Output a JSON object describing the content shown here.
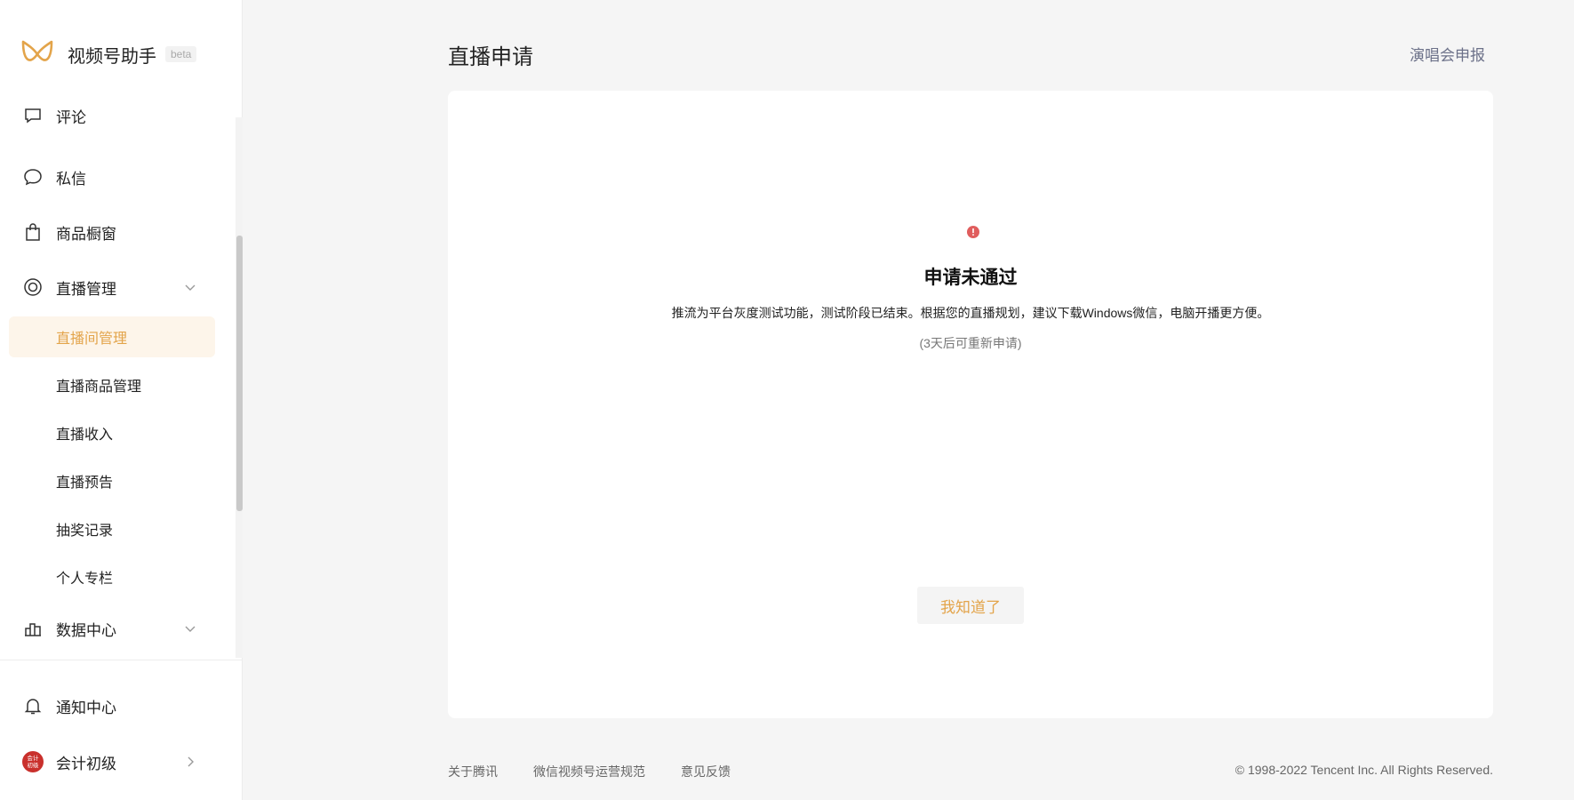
{
  "app": {
    "name": "视频号助手",
    "beta": "beta"
  },
  "colors": {
    "accent": "#e3a44a",
    "active_bg": "#fdf5ea",
    "error": "#e05d5d",
    "link": "#6c7189"
  },
  "sidebar": {
    "items": [
      {
        "label": "评论",
        "icon": "comment-icon"
      },
      {
        "label": "私信",
        "icon": "message-bubble-icon"
      },
      {
        "label": "商品橱窗",
        "icon": "shopping-bag-icon"
      },
      {
        "label": "直播管理",
        "icon": "live-broadcast-icon",
        "expanded": true
      },
      {
        "label": "直播间管理",
        "active": true
      },
      {
        "label": "直播商品管理"
      },
      {
        "label": "直播收入"
      },
      {
        "label": "直播预告"
      },
      {
        "label": "抽奖记录"
      },
      {
        "label": "个人专栏"
      },
      {
        "label": "数据中心",
        "icon": "bar-chart-icon",
        "expanded": false
      }
    ],
    "bottom": {
      "notify": {
        "label": "通知中心",
        "icon": "bell-icon"
      },
      "account": {
        "label": "会计初级",
        "avatar_text": "会计\n初级"
      }
    }
  },
  "header": {
    "title": "直播申请",
    "link": "演唱会申报"
  },
  "status": {
    "title": "申请未通过",
    "description": "推流为平台灰度测试功能，测试阶段已结束。根据您的直播规划，建议下载Windows微信，电脑开播更方便。",
    "note": "(3天后可重新申请)",
    "button": "我知道了"
  },
  "footer": {
    "links": [
      "关于腾讯",
      "微信视频号运营规范",
      "意见反馈"
    ],
    "copyright": "© 1998-2022 Tencent Inc. All Rights Reserved."
  }
}
